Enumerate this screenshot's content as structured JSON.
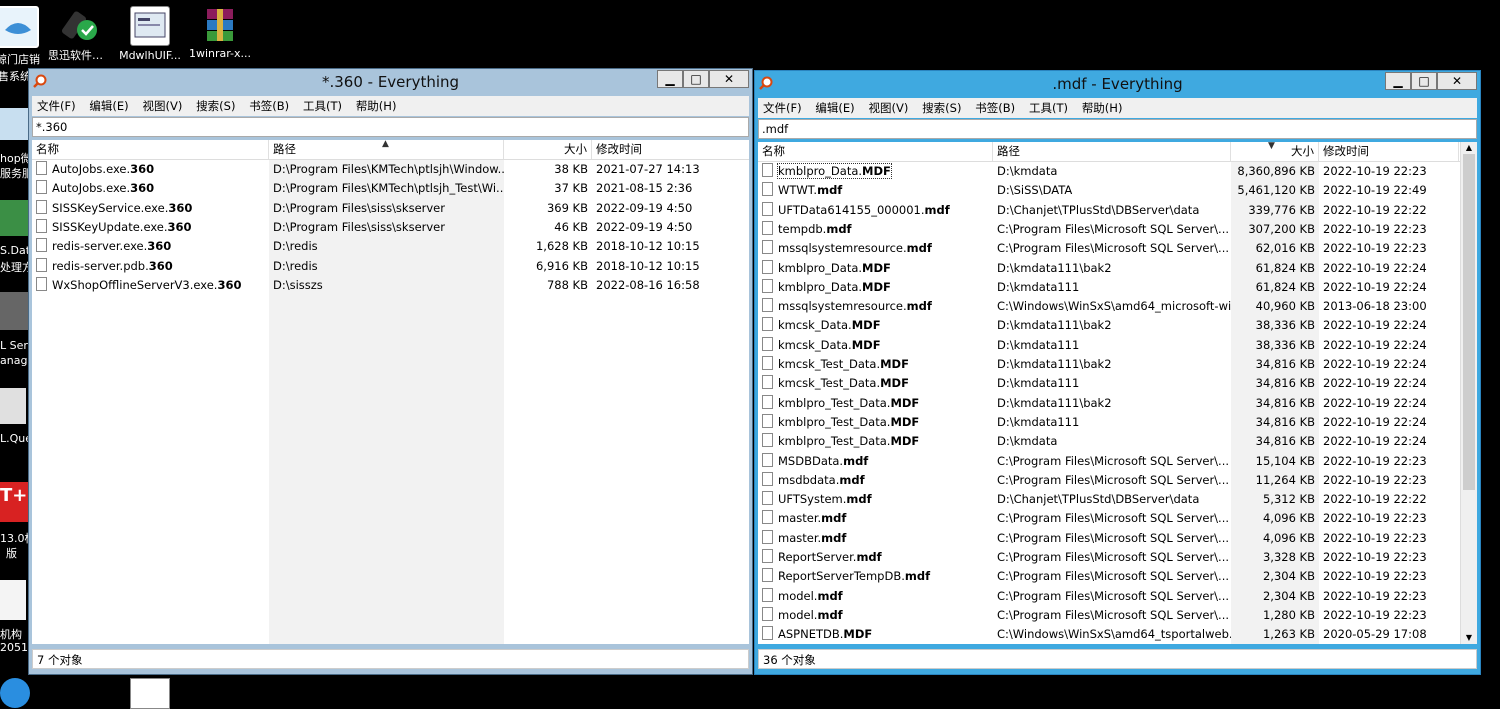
{
  "desktop": {
    "icons": [
      {
        "label": "鲸门店销"
      },
      {
        "label": "思迅软件许可"
      },
      {
        "label": "MdwlhUIF..."
      },
      {
        "label": "1winrar-x..."
      }
    ],
    "side_snippets": [
      "售系统",
      "hop微",
      "服务服",
      "S.Data",
      "处理方",
      "L Serv",
      "anage",
      "L.Quer",
      "T+",
      "13.0标",
      "版",
      "机构",
      "2051"
    ]
  },
  "left_window": {
    "title": "*.360 - Everything",
    "menu": [
      "文件(F)",
      "编辑(E)",
      "视图(V)",
      "搜索(S)",
      "书签(B)",
      "工具(T)",
      "帮助(H)"
    ],
    "search_value": "*.360",
    "columns": {
      "name": "名称",
      "path": "路径",
      "size": "大小",
      "modified": "修改时间"
    },
    "rows": [
      {
        "base": "AutoJobs.exe.",
        "ext": "360",
        "path": "D:\\Program Files\\KMTech\\ptlsjh\\Window...",
        "size": "38 KB",
        "modified": "2021-07-27 14:13"
      },
      {
        "base": "AutoJobs.exe.",
        "ext": "360",
        "path": "D:\\Program Files\\KMTech\\ptlsjh_Test\\Wi...",
        "size": "37 KB",
        "modified": "2021-08-15 2:36"
      },
      {
        "base": "SISSKeyService.exe.",
        "ext": "360",
        "path": "D:\\Program Files\\siss\\skserver",
        "size": "369 KB",
        "modified": "2022-09-19 4:50"
      },
      {
        "base": "SISSKeyUpdate.exe.",
        "ext": "360",
        "path": "D:\\Program Files\\siss\\skserver",
        "size": "46 KB",
        "modified": "2022-09-19 4:50"
      },
      {
        "base": "redis-server.exe.",
        "ext": "360",
        "path": "D:\\redis",
        "size": "1,628 KB",
        "modified": "2018-10-12 10:15"
      },
      {
        "base": "redis-server.pdb.",
        "ext": "360",
        "path": "D:\\redis",
        "size": "6,916 KB",
        "modified": "2018-10-12 10:15"
      },
      {
        "base": "WxShopOfflineServerV3.exe.",
        "ext": "360",
        "path": "D:\\sisszs",
        "size": "788 KB",
        "modified": "2022-08-16 16:58"
      }
    ],
    "status": "7 个对象"
  },
  "right_window": {
    "title": ".mdf - Everything",
    "menu": [
      "文件(F)",
      "编辑(E)",
      "视图(V)",
      "搜索(S)",
      "书签(B)",
      "工具(T)",
      "帮助(H)"
    ],
    "search_value": ".mdf",
    "columns": {
      "name": "名称",
      "path": "路径",
      "size": "大小",
      "modified": "修改时间"
    },
    "rows": [
      {
        "base": "kmblpro_Data.",
        "ext": "MDF",
        "path": "D:\\kmdata",
        "size": "8,360,896 KB",
        "modified": "2022-10-19 22:23"
      },
      {
        "base": "WTWT.",
        "ext": "mdf",
        "path": "D:\\SiSS\\DATA",
        "size": "5,461,120 KB",
        "modified": "2022-10-19 22:49"
      },
      {
        "base": "UFTData614155_000001.",
        "ext": "mdf",
        "path": "D:\\Chanjet\\TPlusStd\\DBServer\\data",
        "size": "339,776 KB",
        "modified": "2022-10-19 22:22"
      },
      {
        "base": "tempdb.",
        "ext": "mdf",
        "path": "C:\\Program Files\\Microsoft SQL Server\\...",
        "size": "307,200 KB",
        "modified": "2022-10-19 22:23"
      },
      {
        "base": "mssqlsystemresource.",
        "ext": "mdf",
        "path": "C:\\Program Files\\Microsoft SQL Server\\...",
        "size": "62,016 KB",
        "modified": "2022-10-19 22:23"
      },
      {
        "base": "kmblpro_Data.",
        "ext": "MDF",
        "path": "D:\\kmdata111\\bak2",
        "size": "61,824 KB",
        "modified": "2022-10-19 22:24"
      },
      {
        "base": "kmblpro_Data.",
        "ext": "MDF",
        "path": "D:\\kmdata111",
        "size": "61,824 KB",
        "modified": "2022-10-19 22:24"
      },
      {
        "base": "mssqlsystemresource.",
        "ext": "mdf",
        "path": "C:\\Windows\\WinSxS\\amd64_microsoft-wi...",
        "size": "40,960 KB",
        "modified": "2013-06-18 23:00"
      },
      {
        "base": "kmcsk_Data.",
        "ext": "MDF",
        "path": "D:\\kmdata111\\bak2",
        "size": "38,336 KB",
        "modified": "2022-10-19 22:24"
      },
      {
        "base": "kmcsk_Data.",
        "ext": "MDF",
        "path": "D:\\kmdata111",
        "size": "38,336 KB",
        "modified": "2022-10-19 22:24"
      },
      {
        "base": "kmcsk_Test_Data.",
        "ext": "MDF",
        "path": "D:\\kmdata111\\bak2",
        "size": "34,816 KB",
        "modified": "2022-10-19 22:24"
      },
      {
        "base": "kmcsk_Test_Data.",
        "ext": "MDF",
        "path": "D:\\kmdata111",
        "size": "34,816 KB",
        "modified": "2022-10-19 22:24"
      },
      {
        "base": "kmblpro_Test_Data.",
        "ext": "MDF",
        "path": "D:\\kmdata111\\bak2",
        "size": "34,816 KB",
        "modified": "2022-10-19 22:24"
      },
      {
        "base": "kmblpro_Test_Data.",
        "ext": "MDF",
        "path": "D:\\kmdata111",
        "size": "34,816 KB",
        "modified": "2022-10-19 22:24"
      },
      {
        "base": "kmblpro_Test_Data.",
        "ext": "MDF",
        "path": "D:\\kmdata",
        "size": "34,816 KB",
        "modified": "2022-10-19 22:24"
      },
      {
        "base": "MSDBData.",
        "ext": "mdf",
        "path": "C:\\Program Files\\Microsoft SQL Server\\...",
        "size": "15,104 KB",
        "modified": "2022-10-19 22:23"
      },
      {
        "base": "msdbdata.",
        "ext": "mdf",
        "path": "C:\\Program Files\\Microsoft SQL Server\\...",
        "size": "11,264 KB",
        "modified": "2022-10-19 22:23"
      },
      {
        "base": "UFTSystem.",
        "ext": "mdf",
        "path": "D:\\Chanjet\\TPlusStd\\DBServer\\data",
        "size": "5,312 KB",
        "modified": "2022-10-19 22:22"
      },
      {
        "base": "master.",
        "ext": "mdf",
        "path": "C:\\Program Files\\Microsoft SQL Server\\...",
        "size": "4,096 KB",
        "modified": "2022-10-19 22:23"
      },
      {
        "base": "master.",
        "ext": "mdf",
        "path": "C:\\Program Files\\Microsoft SQL Server\\...",
        "size": "4,096 KB",
        "modified": "2022-10-19 22:23"
      },
      {
        "base": "ReportServer.",
        "ext": "mdf",
        "path": "C:\\Program Files\\Microsoft SQL Server\\...",
        "size": "3,328 KB",
        "modified": "2022-10-19 22:23"
      },
      {
        "base": "ReportServerTempDB.",
        "ext": "mdf",
        "path": "C:\\Program Files\\Microsoft SQL Server\\...",
        "size": "2,304 KB",
        "modified": "2022-10-19 22:23"
      },
      {
        "base": "model.",
        "ext": "mdf",
        "path": "C:\\Program Files\\Microsoft SQL Server\\...",
        "size": "2,304 KB",
        "modified": "2022-10-19 22:23"
      },
      {
        "base": "model.",
        "ext": "mdf",
        "path": "C:\\Program Files\\Microsoft SQL Server\\...",
        "size": "1,280 KB",
        "modified": "2022-10-19 22:23"
      },
      {
        "base": "ASPNETDB.",
        "ext": "MDF",
        "path": "C:\\Windows\\WinSxS\\amd64_tsportalweb...",
        "size": "1,263 KB",
        "modified": "2020-05-29 17:08"
      }
    ],
    "status": "36 个对象"
  },
  "colors": {
    "desktop": "#000000",
    "left_frame": "#a9c4db",
    "right_frame": "#3fa9e0"
  },
  "icons": [
    "everything-magnifier-icon",
    "file-icon",
    "minimize-icon",
    "maximize-icon",
    "close-icon"
  ]
}
